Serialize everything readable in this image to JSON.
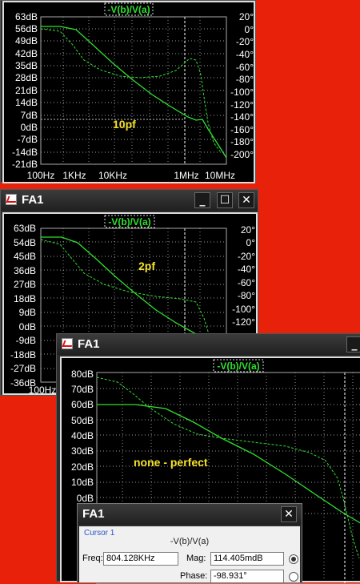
{
  "colors": {
    "background": "#e8220a",
    "trace": "#2fe02f",
    "annotation": "#f5e12a"
  },
  "window1": {
    "trace_title": "-V(b)/V(a)",
    "annotation": "10pf",
    "y_left": [
      "63dB",
      "56dB",
      "49dB",
      "42dB",
      "35dB",
      "28dB",
      "21dB",
      "14dB",
      "7dB",
      "0dB",
      "-7dB",
      "-14dB",
      "-21dB"
    ],
    "y_right": [
      "20°",
      "0°",
      "-20°",
      "-40°",
      "-60°",
      "-80°",
      "-100°",
      "-120°",
      "-140°",
      "-160°",
      "-180°",
      "-200°"
    ],
    "x_ticks": [
      "100Hz",
      "1KHz",
      "10KHz",
      "1MHz",
      "10MHz"
    ]
  },
  "window2": {
    "title": "FA1",
    "icon": "waveform-icon",
    "buttons": {
      "minimize": "_",
      "maximize": "☐",
      "close": "✕"
    },
    "trace_title": "-V(b)/V(a)",
    "annotation": "2pf",
    "y_left": [
      "63dB",
      "54dB",
      "45dB",
      "36dB",
      "27dB",
      "18dB",
      "9dB",
      "0dB",
      "-9dB",
      "-18dB",
      "-27dB",
      "-36dB"
    ],
    "y_right": [
      "20°",
      "0°",
      "-20°",
      "-40°",
      "-60°",
      "-80°",
      "-100°",
      "-120°"
    ],
    "x_ticks": [
      "100Hz"
    ]
  },
  "window3": {
    "title": "FA1",
    "icon": "waveform-icon",
    "buttons": {
      "minimize": "_"
    },
    "trace_title": "-V(b)/V(a)",
    "annotation": "none - perfect",
    "y_left": [
      "80dB",
      "70dB",
      "60dB",
      "50dB",
      "40dB",
      "30dB",
      "20dB",
      "10dB",
      "0dB"
    ]
  },
  "cursor_dialog": {
    "title": "FA1",
    "close": "✕",
    "group": "Cursor 1",
    "function": "-V(b)/V(a)",
    "freq_label": "Freq:",
    "freq_value": "804.128KHz",
    "mag_label": "Mag:",
    "mag_value": "114.405mdB",
    "phase_label": "Phase:",
    "phase_value": "-98.931°"
  }
}
